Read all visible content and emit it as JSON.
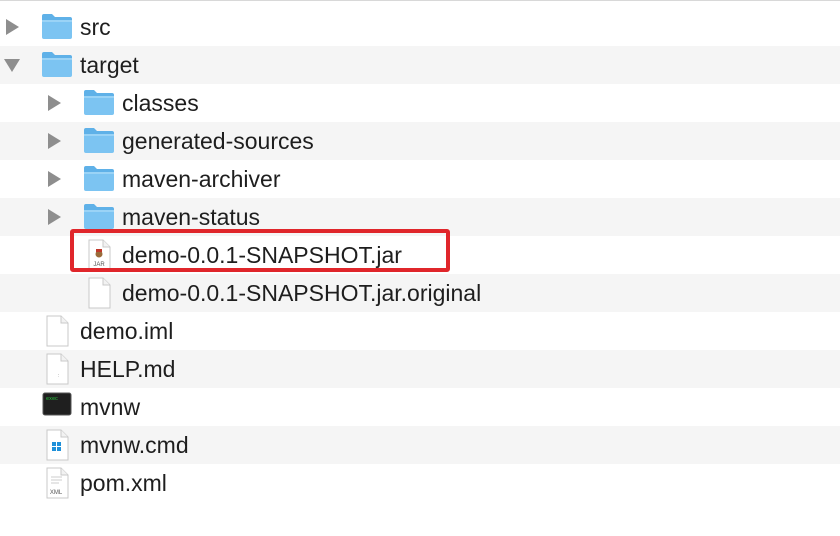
{
  "files": [
    {
      "key": "src",
      "name": "src",
      "type": "folder",
      "depth": 0,
      "expand": "closed"
    },
    {
      "key": "target",
      "name": "target",
      "type": "folder",
      "depth": 0,
      "expand": "open"
    },
    {
      "key": "classes",
      "name": "classes",
      "type": "folder",
      "depth": 1,
      "expand": "closed"
    },
    {
      "key": "generated-sources",
      "name": "generated-sources",
      "type": "folder",
      "depth": 1,
      "expand": "closed"
    },
    {
      "key": "maven-archiver",
      "name": "maven-archiver",
      "type": "folder",
      "depth": 1,
      "expand": "closed"
    },
    {
      "key": "maven-status",
      "name": "maven-status",
      "type": "folder",
      "depth": 1,
      "expand": "closed"
    },
    {
      "key": "jar",
      "name": "demo-0.0.1-SNAPSHOT.jar",
      "type": "jar",
      "depth": 1,
      "highlighted": true
    },
    {
      "key": "jar-original",
      "name": "demo-0.0.1-SNAPSHOT.jar.original",
      "type": "doc",
      "depth": 1
    },
    {
      "key": "demo-iml",
      "name": "demo.iml",
      "type": "doc",
      "depth": 0
    },
    {
      "key": "help-md",
      "name": "HELP.md",
      "type": "md",
      "depth": 0
    },
    {
      "key": "mvnw",
      "name": "mvnw",
      "type": "exec",
      "depth": 0
    },
    {
      "key": "mvnw-cmd",
      "name": "mvnw.cmd",
      "type": "cmd",
      "depth": 0
    },
    {
      "key": "pom-xml",
      "name": "pom.xml",
      "type": "xml",
      "depth": 0
    }
  ],
  "icon_labels": {
    "jar": "JAR",
    "xml": "XML",
    "exec": "exec"
  },
  "colors": {
    "folder": "#7cc4f2",
    "folder_dark": "#5fb1e8",
    "highlight": "#e0262b",
    "alt_row": "#f5f5f5"
  }
}
